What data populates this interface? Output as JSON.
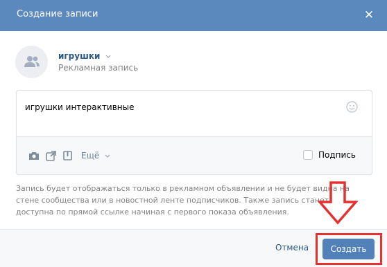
{
  "dialog": {
    "title": "Создание записи",
    "close_icon": "close-icon"
  },
  "owner": {
    "name": "игрушки",
    "subtitle": "Рекламная запись",
    "avatar_icon": "users-icon"
  },
  "editor": {
    "text": "игрушки интерактивные",
    "emoji_icon": "smiley-icon",
    "toolbar": {
      "photo_icon": "camera-icon",
      "video_icon": "video-icon",
      "audio_icon": "bookmark-icon",
      "more_label": "Ещё"
    },
    "signature": {
      "label": "Подпись",
      "checked": false
    }
  },
  "note": "Запись будет отображаться только в рекламном объявлении и не будет видна на стене сообщества или в новостной ленте подписчиков. Также запись станет доступна по прямой ссылке начиная с первого показа объявления.",
  "footer": {
    "cancel_label": "Отмена",
    "create_label": "Создать"
  },
  "colors": {
    "header": "#5b88bd",
    "primary_button": "#5181b8",
    "link": "#2a5885",
    "annotation": "#e53030"
  }
}
